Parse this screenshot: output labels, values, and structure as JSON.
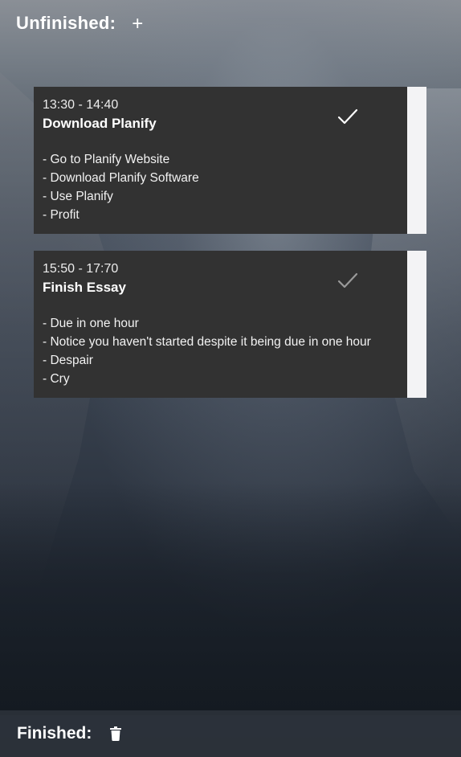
{
  "header": {
    "title": "Unfinished:",
    "add_label": "+"
  },
  "tasks": [
    {
      "time": "13:30 - 14:40",
      "title": "Download Planify",
      "items": [
        "- Go to Planify Website",
        "- Download Planify Software",
        "- Use Planify",
        "- Profit"
      ],
      "check_icon": "check-icon",
      "check_color": "#ffffff"
    },
    {
      "time": "15:50 - 17:70",
      "title": "Finish Essay",
      "items": [
        "- Due in one hour",
        "- Notice you haven't started despite it being due in one hour",
        "- Despair",
        "- Cry"
      ],
      "check_icon": "check-icon",
      "check_color": "#9a9a9a"
    }
  ],
  "footer": {
    "title": "Finished:",
    "trash_icon": "trash-icon"
  },
  "colors": {
    "card": "#323232",
    "stripe": "#f3f3f5",
    "text": "#ffffff"
  }
}
